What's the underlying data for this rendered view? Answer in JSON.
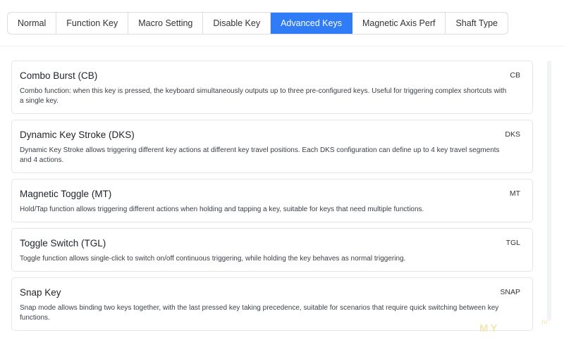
{
  "tabs": [
    {
      "label": "Normal",
      "active": false
    },
    {
      "label": "Function Key",
      "active": false
    },
    {
      "label": "Macro Setting",
      "active": false
    },
    {
      "label": "Disable Key",
      "active": false
    },
    {
      "label": "Advanced Keys",
      "active": true
    },
    {
      "label": "Magnetic Axis Perf",
      "active": false
    },
    {
      "label": "Shaft Type",
      "active": false
    }
  ],
  "cards": [
    {
      "title": "Combo Burst (CB)",
      "code": "CB",
      "description": "Combo function: when this key is pressed, the keyboard simultaneously outputs up to three pre-configured keys. Useful for triggering complex shortcuts with a single key."
    },
    {
      "title": "Dynamic Key Stroke (DKS)",
      "code": "DKS",
      "description": "Dynamic Key Stroke allows triggering different key actions at different key travel positions. Each DKS configuration can define up to 4 key travel segments and 4 actions."
    },
    {
      "title": "Magnetic Toggle (MT)",
      "code": "MT",
      "description": "Hold/Tap function allows triggering different actions when holding and tapping a key, suitable for keys that need multiple functions."
    },
    {
      "title": "Toggle Switch (TGL)",
      "code": "TGL",
      "description": "Toggle function allows single-click to switch on/off continuous triggering, while holding the key behaves as normal triggering."
    },
    {
      "title": "Snap Key",
      "code": "SNAP",
      "description": "Snap mode allows binding two keys together, with the last pressed key taking precedence, suitable for scenarios that require quick switching between key functions."
    }
  ],
  "watermark": {
    "text": "MY",
    "sub": ".ru"
  },
  "colors": {
    "accent": "#2f7cf6",
    "border": "#e3e6ea"
  }
}
